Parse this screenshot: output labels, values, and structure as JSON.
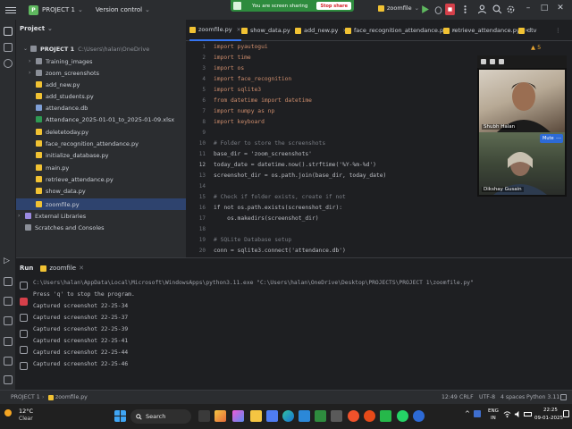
{
  "titlebar": {
    "project_badge": "P",
    "project_name": "PROJECT 1",
    "vcs": "Version control",
    "run_config": "zoomfile"
  },
  "share_bar": {
    "text": "You are screen sharing",
    "stop_label": "Stop share"
  },
  "project_panel": {
    "title": "Project",
    "root": {
      "label": "PROJECT 1",
      "path": "C:\\Users\\halan\\OneDrive\\Desktop\\PROJECTS\\PROJ"
    },
    "items": [
      {
        "label": "Training_images",
        "kind": "folder"
      },
      {
        "label": "zoom_screenshots",
        "kind": "folder"
      },
      {
        "label": "add_new.py",
        "kind": "py"
      },
      {
        "label": "add_students.py",
        "kind": "py"
      },
      {
        "label": "attendance.db",
        "kind": "db"
      },
      {
        "label": "Attendance_2025-01-01_to_2025-01-09.xlsx",
        "kind": "xls"
      },
      {
        "label": "deletetoday.py",
        "kind": "py"
      },
      {
        "label": "face_recognition_attendance.py",
        "kind": "py"
      },
      {
        "label": "initialize_database.py",
        "kind": "py"
      },
      {
        "label": "main.py",
        "kind": "py"
      },
      {
        "label": "retrieve_attendance.py",
        "kind": "py"
      },
      {
        "label": "show_data.py",
        "kind": "py"
      },
      {
        "label": "zoomfile.py",
        "kind": "py"
      }
    ],
    "external_libraries": "External Libraries",
    "scratches": "Scratches and Consoles"
  },
  "tabs": [
    "zoomfile.py",
    "show_data.py",
    "add_new.py",
    "face_recognition_attendance.py",
    "retrieve_attendance.py",
    "dtv"
  ],
  "editor": {
    "warning_count": "5",
    "line_numbers": [
      "1",
      "2",
      "3",
      "4",
      "5",
      "6",
      "7",
      "8",
      "9",
      "10",
      "11",
      "12",
      "13",
      "14",
      "15",
      "16",
      "17",
      "18",
      "19",
      "20"
    ],
    "lines": [
      "import pyautogui",
      "import time",
      "import os",
      "import face_recognition",
      "import sqlite3",
      "from datetime import datetime",
      "import numpy as np",
      "import keyboard",
      "",
      "# Folder to store the screenshots",
      "base_dir = 'zoom_screenshots'",
      "today_date = datetime.now().strftime('%Y-%m-%d')",
      "screenshot_dir = os.path.join(base_dir, today_date)",
      "",
      "# Check if folder exists, create if not",
      "if not os.path.exists(screenshot_dir):",
      "    os.makedirs(screenshot_dir)",
      "",
      "# SQLite Database setup",
      "conn = sqlite3.connect('attendance.db')"
    ]
  },
  "video": {
    "participant_1": "Shubh Halan",
    "participant_2": "Dikshay Gusain",
    "mute_label": "Mute",
    "more_label": "…"
  },
  "run_panel": {
    "title": "Run",
    "config": "zoomfile",
    "output": [
      "C:\\Users\\halan\\AppData\\Local\\Microsoft\\WindowsApps\\python3.11.exe \"C:\\Users\\halan\\OneDrive\\Desktop\\PROJECTS\\PROJECT 1\\zoomfile.py\"",
      "Press 'q' to stop the program.",
      "Captured screenshot 22-25-34",
      "Captured screenshot 22-25-37",
      "Captured screenshot 22-25-39",
      "Captured screenshot 22-25-41",
      "Captured screenshot 22-25-44",
      "Captured screenshot 22-25-46"
    ]
  },
  "status_bar": {
    "crumb_project": "PROJECT 1",
    "crumb_file": "zoomfile.py",
    "position": "12:49",
    "line_ending": "CRLF",
    "encoding": "UTF-8",
    "indent": "4 spaces",
    "interpreter": "Python 3.11"
  },
  "taskbar": {
    "temperature": "12°C",
    "weather": "Clear",
    "search": "Search",
    "lang_1": "ENG",
    "lang_2": "IN",
    "time": "22:25",
    "date": "09-01-2025"
  }
}
